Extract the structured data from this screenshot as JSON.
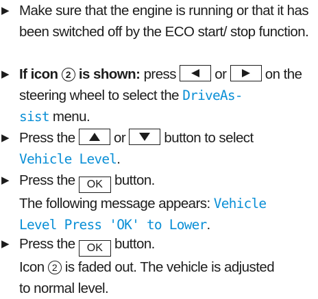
{
  "steps": [
    {
      "text": "Make sure that the engine is running or that it has been switched off by the ECO start/ stop function."
    },
    {
      "condition_prefix": "If icon",
      "icon_number": "2",
      "condition_suffix": "is shown:",
      "action_prefix": "press",
      "connector": "or",
      "action_suffix": "on the steering wheel to select the",
      "menu_name": "DriveAssist",
      "menu_part1": "DriveAs-",
      "menu_part2": "sist",
      "after_menu": "menu."
    },
    {
      "prefix": "Press the",
      "connector": "or",
      "suffix": "button to select",
      "menu_item": "Vehicle Level",
      "period": "."
    },
    {
      "prefix": "Press the",
      "key_label": "OK",
      "suffix": "button.",
      "message_intro": "The following message appears:",
      "message_part1": "Vehicle",
      "message_part2": "Level Press 'OK' to Lower",
      "period": "."
    },
    {
      "prefix": "Press the",
      "key_label": "OK",
      "suffix": "button.",
      "result_prefix": "Icon",
      "icon_number": "2",
      "result_line1_end": "is faded out. The vehicle is adjusted",
      "result_line2": "to normal level."
    }
  ],
  "icons": {
    "bullet": "right-triangle-arrow",
    "key_left": "left-triangle",
    "key_right": "right-triangle",
    "key_up": "up-triangle",
    "key_down": "down-triangle"
  }
}
